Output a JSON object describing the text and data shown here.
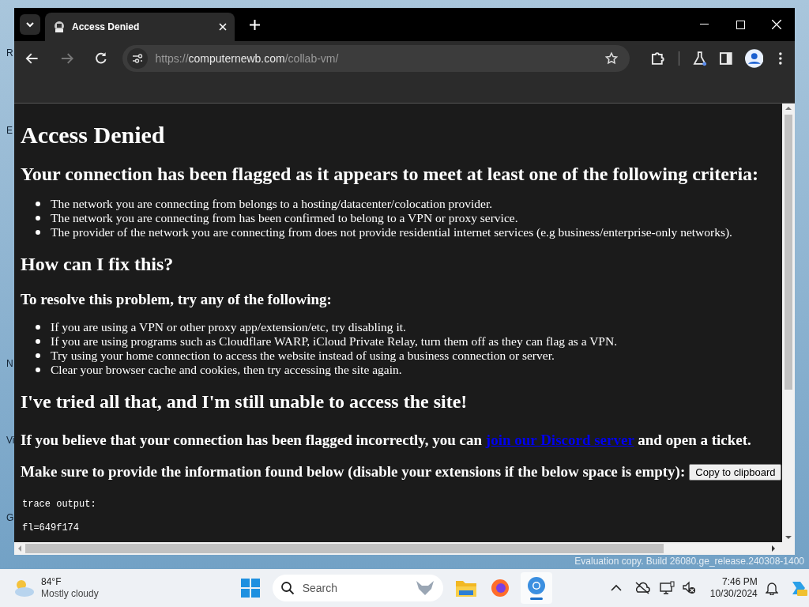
{
  "desktop": {
    "icon_labels": [
      "R",
      "E",
      "N",
      "Vi",
      "G"
    ],
    "watermark": "Evaluation copy. Build 26080.ge_release.240308-1400"
  },
  "browser": {
    "tabs": [
      {
        "title": "Access Denied",
        "selected": true
      }
    ],
    "address": {
      "scheme": "https://",
      "host": "computernewb.com",
      "path": "/collab-vm/"
    }
  },
  "page": {
    "blocks": [
      {
        "kind": "h1",
        "text": "Access Denied"
      },
      {
        "kind": "h2",
        "text": "Your connection has been flagged as it appears to meet at least one of the following criteria:"
      },
      {
        "kind": "list",
        "items": [
          "The network you are connecting from belongs to a hosting/datacenter/colocation provider.",
          "The network you are connecting from has been confirmed to belong to a VPN or proxy service.",
          "The provider of the network you are connecting from does not provide residential internet services (e.g business/enterprise-only networks)."
        ]
      },
      {
        "kind": "h2",
        "text": "How can I fix this?"
      },
      {
        "kind": "h3",
        "text": "To resolve this problem, try any of the following:"
      },
      {
        "kind": "list",
        "items": [
          "If you are using a VPN or other proxy app/extension/etc, try disabling it.",
          "If you are using programs such as Cloudflare WARP, iCloud Private Relay, turn them off as they can flag as a VPN.",
          "Try using your home connection to access the website instead of using a business connection or server.",
          "Clear your browser cache and cookies, then try accessing the site again."
        ]
      },
      {
        "kind": "h2",
        "text": "I've tried all that, and I'm still unable to access the site!"
      },
      {
        "kind": "link_line",
        "before": "If you believe that your connection has been flagged incorrectly, you can",
        "link": "join our Discord server",
        "after": "and open a ticket."
      },
      {
        "kind": "button_line",
        "text": "Make sure to provide the information found below (disable your extensions if the below space is empty):",
        "button": "Copy to clipboard"
      },
      {
        "kind": "pre",
        "lines": [
          "trace output:",
          "fl=649f174"
        ]
      }
    ]
  },
  "taskbar": {
    "temperature": "84°F",
    "condition": "Mostly cloudy",
    "search_placeholder": "Search",
    "time": "7:46 PM",
    "date": "10/30/2024"
  }
}
